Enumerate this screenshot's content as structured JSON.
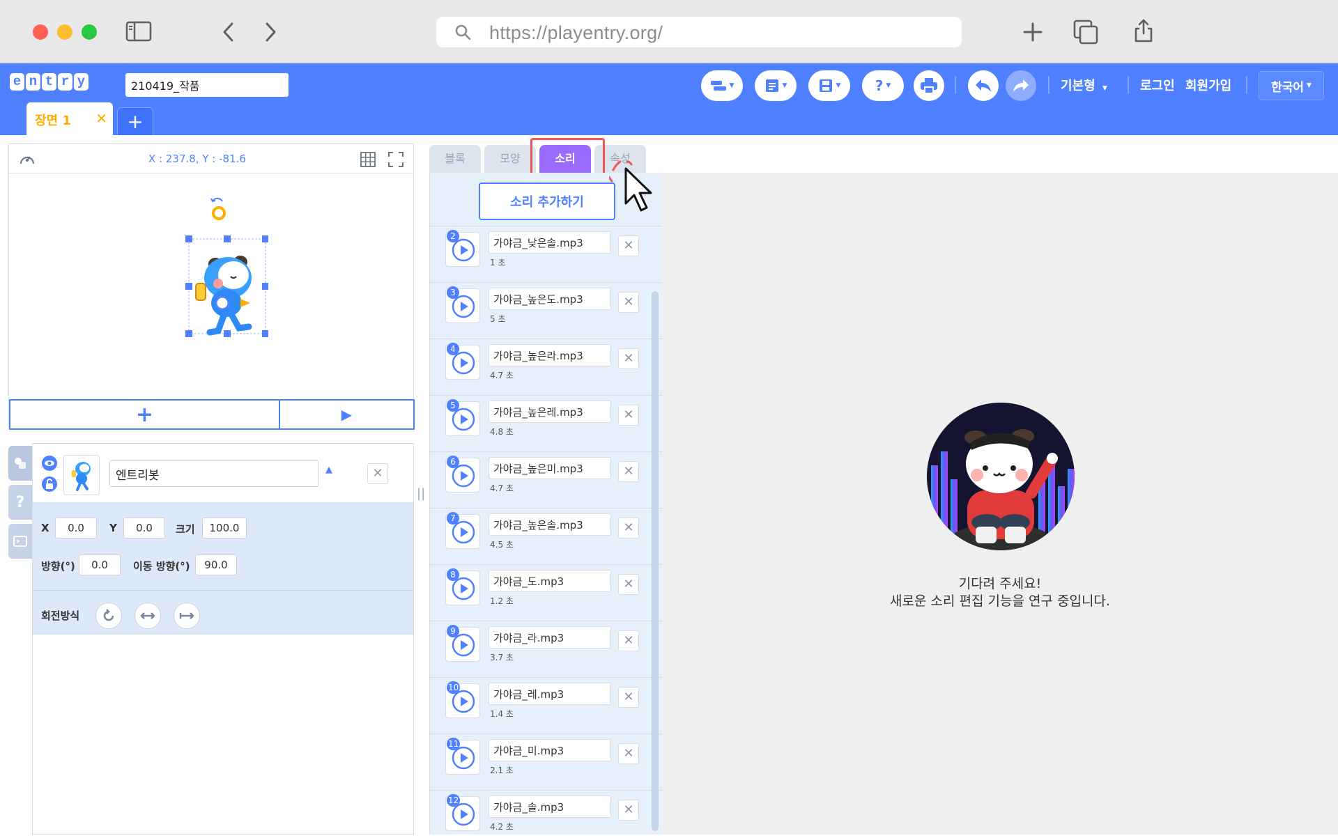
{
  "browser": {
    "url": "https://playentry.org/"
  },
  "header": {
    "logo_letters": [
      "e",
      "n",
      "t",
      "r",
      "y"
    ],
    "project_name": "210419_작품",
    "mode_label": "기본형",
    "login_label": "로그인",
    "signup_label": "회원가입",
    "language_label": "한국어",
    "scene_tab_label": "장면 1",
    "scene_add_label": "+"
  },
  "stage": {
    "coords": "X : 237.8, Y : -81.6",
    "add_label": "+",
    "play_label": "▶"
  },
  "object": {
    "name": "엔트리봇",
    "x_label": "X",
    "x_value": "0.0",
    "y_label": "Y",
    "y_value": "0.0",
    "size_label": "크기",
    "size_value": "100.0",
    "direction_label": "방향(°)",
    "direction_value": "0.0",
    "move_direction_label": "이동 방향(°)",
    "move_direction_value": "90.0",
    "rotation_label": "회전방식"
  },
  "tabs": [
    {
      "label": "블록",
      "active": false
    },
    {
      "label": "모양",
      "active": false
    },
    {
      "label": "소리",
      "active": true
    },
    {
      "label": "속성",
      "active": false
    }
  ],
  "sound_panel": {
    "add_button": "소리 추가하기",
    "items": [
      {
        "num": "2",
        "name": "가야금_낮은솔.mp3",
        "duration": "1 초"
      },
      {
        "num": "3",
        "name": "가야금_높은도.mp3",
        "duration": "5 초"
      },
      {
        "num": "4",
        "name": "가야금_높은라.mp3",
        "duration": "4.7 초"
      },
      {
        "num": "5",
        "name": "가야금_높은레.mp3",
        "duration": "4.8 초"
      },
      {
        "num": "6",
        "name": "가야금_높은미.mp3",
        "duration": "4.7 초"
      },
      {
        "num": "7",
        "name": "가야금_높은솔.mp3",
        "duration": "4.5 초"
      },
      {
        "num": "8",
        "name": "가야금_도.mp3",
        "duration": "1.2 초"
      },
      {
        "num": "9",
        "name": "가야금_라.mp3",
        "duration": "3.7 초"
      },
      {
        "num": "10",
        "name": "가야금_레.mp3",
        "duration": "1.4 초"
      },
      {
        "num": "11",
        "name": "가야금_미.mp3",
        "duration": "2.1 초"
      },
      {
        "num": "12",
        "name": "가야금_솔.mp3",
        "duration": "4.2 초"
      }
    ]
  },
  "editor_placeholder": {
    "title": "기다려 주세요!",
    "subtitle": "새로운 소리 편집 기능을 연구 중입니다."
  },
  "colors": {
    "brand_blue": "#4f80ff",
    "sound_tab_purple": "#9a6bff",
    "highlight_red": "#f05656",
    "scene_orange": "#ffae00"
  },
  "icons": [
    "sidebar-toggle-icon",
    "back-icon",
    "forward-icon",
    "search-icon",
    "new-tab-icon",
    "tabs-icon",
    "share-icon",
    "pointer-cursor-icon"
  ]
}
